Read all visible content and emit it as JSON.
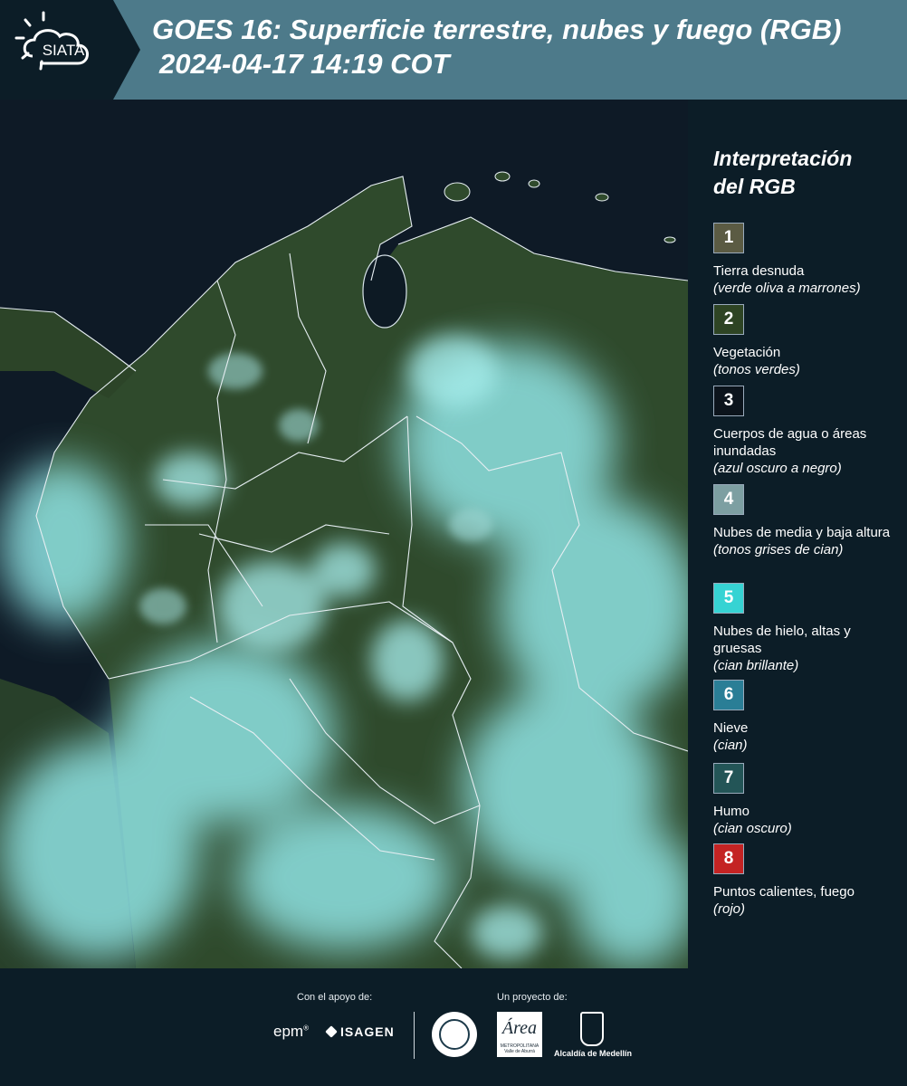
{
  "header": {
    "logo_text": "SIATA",
    "title_line1": "GOES 16: Superficie terrestre, nubes y fuego (RGB)",
    "title_line2": "2024-04-17 14:19 COT"
  },
  "legend": {
    "title_line1": "Interpretación",
    "title_line2": "del RGB",
    "items": [
      {
        "num": "1",
        "label": "Tierra desnuda",
        "note": "(verde oliva a marrones)",
        "color": "#5b5b43"
      },
      {
        "num": "2",
        "label": "Vegetación",
        "note": "(tonos verdes)",
        "color": "#2e4424"
      },
      {
        "num": "3",
        "label": "Cuerpos de agua o áreas inundadas",
        "note": "(azul oscuro a negro)",
        "color": "#0c141c"
      },
      {
        "num": "4",
        "label": "Nubes de media y baja altura",
        "note": "(tonos grises de cian)",
        "color": "#7d9fa2"
      },
      {
        "num": "5",
        "label": "Nubes de hielo, altas y gruesas",
        "note": "(cian brillante)",
        "color": "#36d3d3"
      },
      {
        "num": "6",
        "label": "Nieve",
        "note": "(cian)",
        "color": "#2a7e96"
      },
      {
        "num": "7",
        "label": "Humo",
        "note": "(cian oscuro)",
        "color": "#235557"
      },
      {
        "num": "8",
        "label": "Puntos calientes, fuego",
        "note": "(rojo)",
        "color": "#c42323"
      }
    ]
  },
  "footer": {
    "support_label": "Con el apoyo de:",
    "project_label": "Un proyecto de:",
    "epm": "epm",
    "isagen": "ISAGEN",
    "area_logo": "Área",
    "area_logo_sub": "METROPOLITANA Valle de Aburrá",
    "medellin": "Alcaldía de Medellín"
  },
  "colors": {
    "header_bg": "#4d7a8a",
    "panel_bg": "#0c1d27",
    "vegetation": "#2f4a2c",
    "cloud_cyan": "#8fe3e3"
  }
}
